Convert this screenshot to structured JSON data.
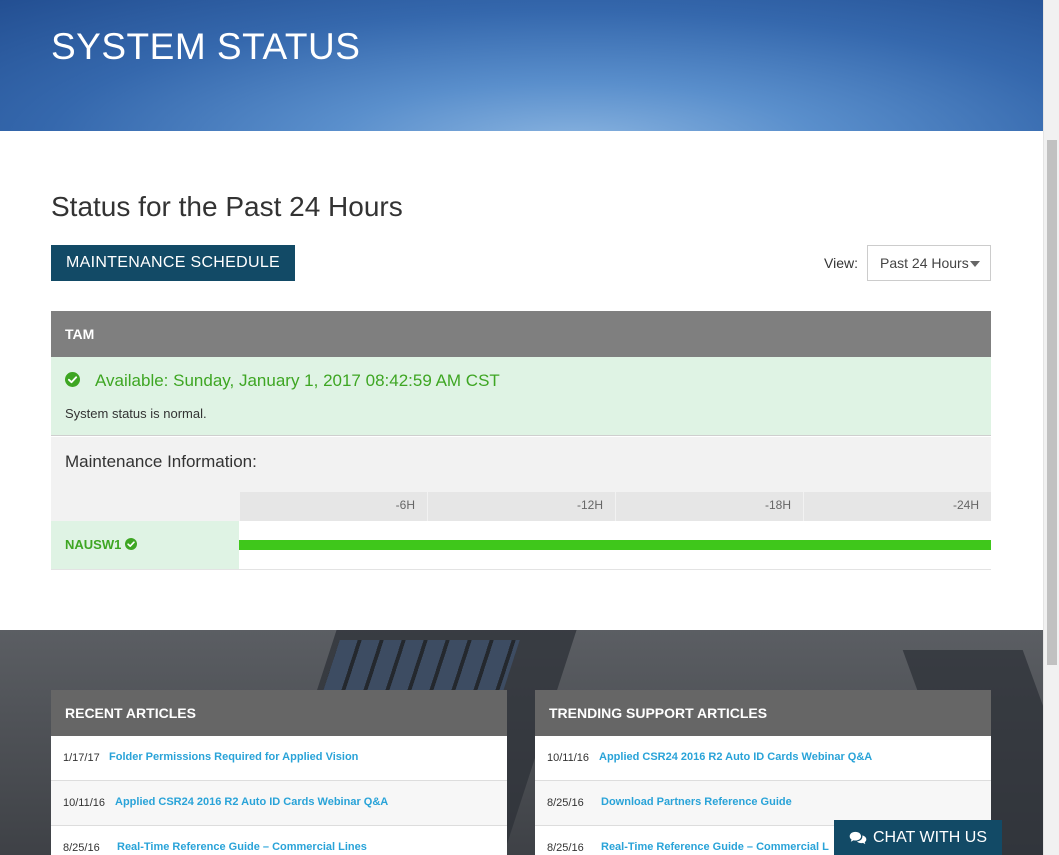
{
  "hero": {
    "title": "SYSTEM STATUS"
  },
  "status": {
    "heading": "Status for the Past 24 Hours",
    "maintenance_button": "MAINTENANCE SCHEDULE",
    "view_label": "View:",
    "view_selected": "Past 24 Hours"
  },
  "panel": {
    "title": "TAM",
    "available_text": "Available: Sunday, January 1, 2017 08:42:59 AM CST",
    "normal_text": "System status is normal.",
    "maintenance_label": "Maintenance Information:",
    "timeline": [
      "-6H",
      "-12H",
      "-18H",
      "-24H"
    ],
    "service": {
      "name": "NAUSW1",
      "uptime_fraction": 1.0
    }
  },
  "colors": {
    "brand": "#124a66",
    "ok": "#3ea623",
    "bar": "#3fc71b",
    "link": "#29a3d8"
  },
  "recent": {
    "title": "RECENT ARTICLES",
    "items": [
      {
        "date": "1/17/17",
        "title": "Folder Permissions Required for Applied Vision"
      },
      {
        "date": "10/11/16",
        "title": "Applied CSR24 2016 R2 Auto ID Cards Webinar Q&A"
      },
      {
        "date": "8/25/16",
        "title": "Real-Time Reference Guide – Commercial Lines"
      }
    ]
  },
  "trending": {
    "title": "TRENDING SUPPORT ARTICLES",
    "items": [
      {
        "date": "10/11/16",
        "title": "Applied CSR24 2016 R2 Auto ID Cards Webinar Q&A"
      },
      {
        "date": "8/25/16",
        "title": "Download Partners Reference Guide"
      },
      {
        "date": "8/25/16",
        "title": "Real-Time Reference Guide – Commercial L"
      }
    ]
  },
  "chat": {
    "label": "CHAT WITH US"
  }
}
